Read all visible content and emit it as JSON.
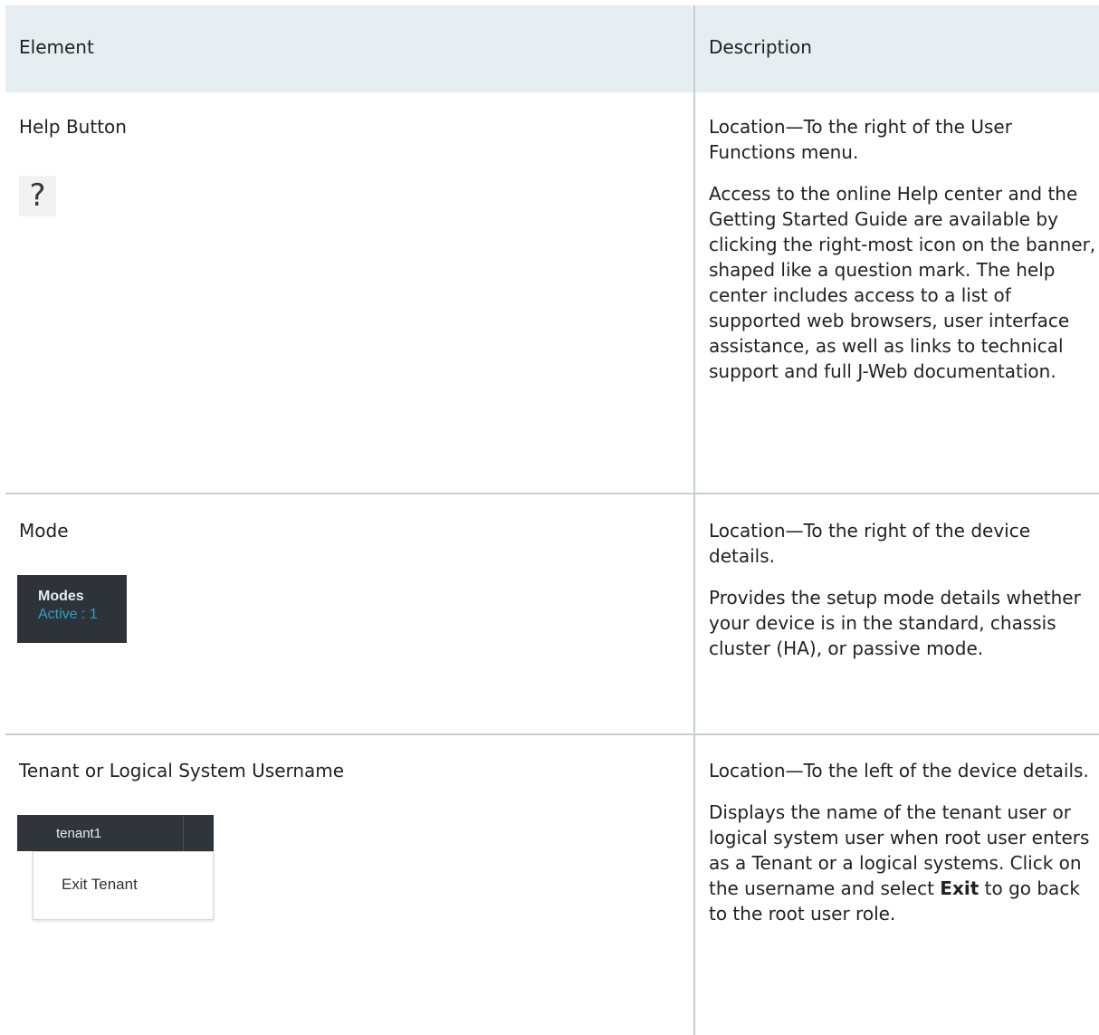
{
  "table": {
    "headers": {
      "element": "Element",
      "description": "Description"
    },
    "rows": [
      {
        "element": "Help Button",
        "icon": "question-mark-icon",
        "icon_glyph": "?",
        "description": [
          "Location—To the right of the User Functions menu.",
          "Access to the online Help center and the Getting Started Guide are available by clicking the right-most icon on the banner, shaped like a question mark. The help center includes access to a list of supported web browsers, user interface assistance, as well as links to technical support and full J-Web documentation."
        ]
      },
      {
        "element": "Mode",
        "widget": {
          "title": "Modes",
          "active": "Active : 1"
        },
        "description": [
          "Location—To the right of the device details.",
          "Provides the setup mode details whether your device is in the standard, chassis cluster (HA), or passive mode."
        ]
      },
      {
        "element": "Tenant or Logical System Username",
        "widget": {
          "username": "tenant1",
          "menu_item": "Exit Tenant"
        },
        "description": [
          "Location—To the left of the device details.",
          "Displays the name of the tenant user or logical system user when root user enters as a Tenant or a logical systems. Click on the username and select",
          "Exit",
          "to go back to the root user role."
        ]
      }
    ]
  },
  "colors": {
    "header_bg": "#e6eef1",
    "divider": "#c3ced6",
    "widget_dark": "#2d3338",
    "active_accent": "#27a4c9"
  }
}
